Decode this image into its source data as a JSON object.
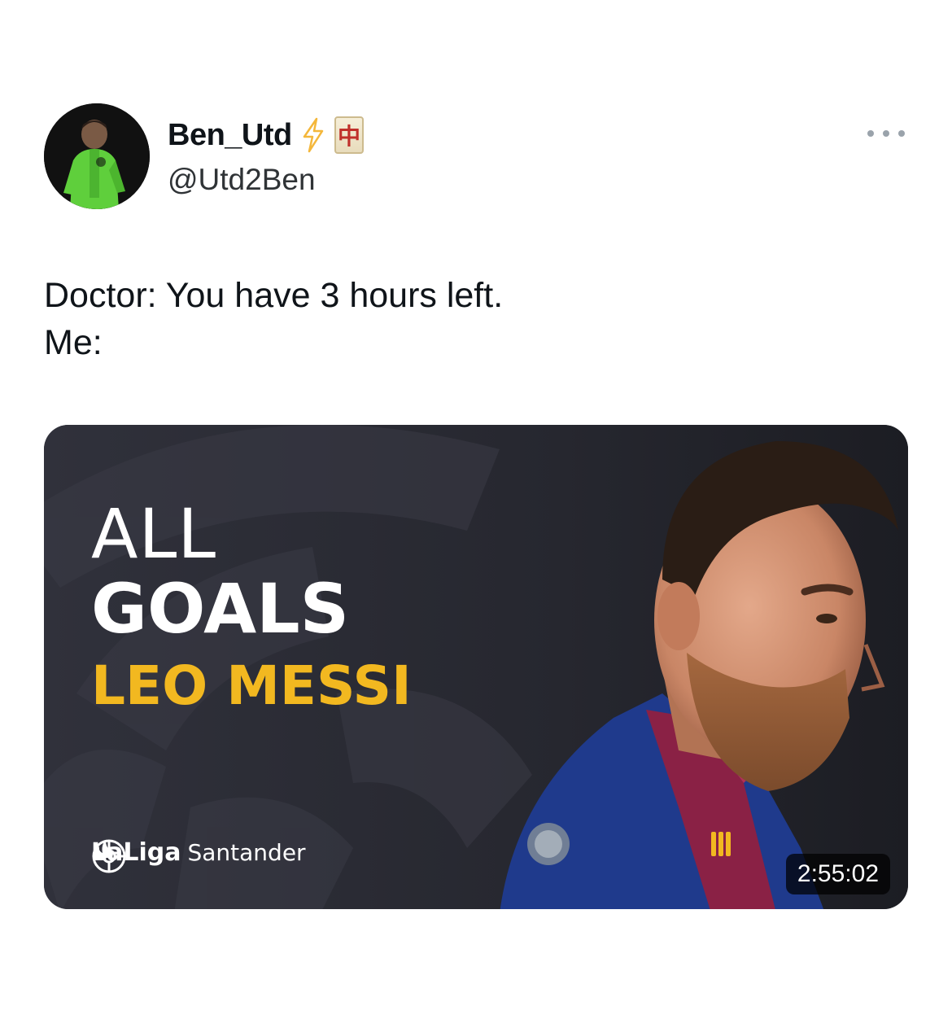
{
  "tweet": {
    "display_name": "Ben_Utd",
    "handle": "@Utd2Ben",
    "badges": [
      "lightning-bolt-icon",
      "mahjong-red-dragon-icon"
    ],
    "mahjong_glyph": "中",
    "text_lines": [
      "Doctor: You have 3 hours left.",
      "Me:"
    ]
  },
  "video": {
    "title_line1": "ALL",
    "title_line2": "GOALS",
    "title_line3": "LEO MESSI",
    "brand_left": "LaLiga",
    "brand_right": "Santander",
    "duration": "2:55:02"
  },
  "colors": {
    "accent_gold": "#f2b820",
    "thumbnail_bg": "#2a2b33",
    "bolt": "#f4b73b",
    "handle_text": "#2f3336"
  }
}
